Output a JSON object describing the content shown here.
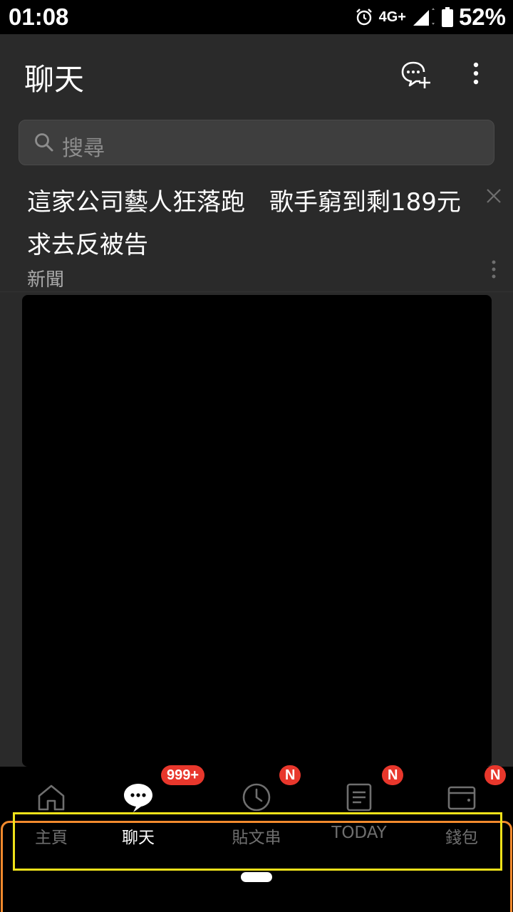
{
  "status_bar": {
    "time": "01:08",
    "network": "4G+",
    "battery_percent": "52%"
  },
  "header": {
    "title": "聊天",
    "new_chat_icon": "chat-bubble-plus-icon",
    "more_icon": "vertical-dots-icon"
  },
  "search": {
    "placeholder": "搜尋"
  },
  "news": {
    "title": "這家公司藝人狂落跑　歌手窮到剩189元求去反被告",
    "source": "新聞"
  },
  "bottom_nav": {
    "items": [
      {
        "label": "主頁",
        "icon": "home-icon",
        "active": false
      },
      {
        "label": "聊天",
        "icon": "chat-bubble-icon",
        "active": true,
        "badge": "999+"
      },
      {
        "label": "貼文串",
        "icon": "clock-icon",
        "active": false,
        "badge": "N"
      },
      {
        "label": "TODAY",
        "icon": "document-icon",
        "active": false,
        "badge": "N"
      },
      {
        "label": "錢包",
        "icon": "wallet-icon",
        "active": false,
        "badge": "N"
      }
    ]
  },
  "colors": {
    "badge": "#e8372c",
    "highlight_yellow": "#f0e21a",
    "highlight_orange": "#f28a2d"
  }
}
